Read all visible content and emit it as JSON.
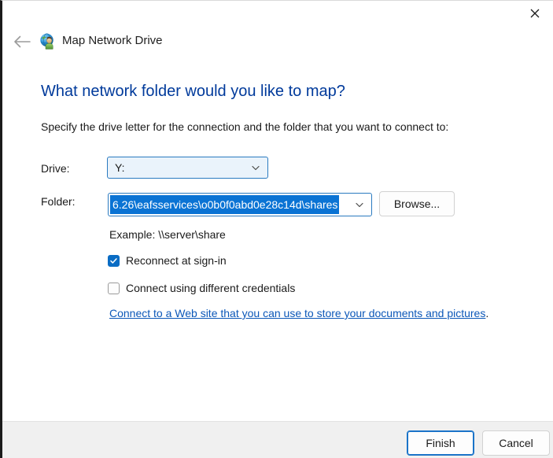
{
  "window": {
    "title": "Map Network Drive",
    "icon": "network-drive-globe-icon",
    "close_label": "✕",
    "back_label": "←"
  },
  "content": {
    "heading": "What network folder would you like to map?",
    "instruction": "Specify the drive letter for the connection and the folder that you want to connect to:",
    "drive": {
      "label": "Drive:",
      "value": "Y:",
      "options": [
        "Y:"
      ]
    },
    "folder": {
      "label": "Folder:",
      "value": "6.26\\eafsservices\\o0b0f0abd0e28c14d\\shares",
      "selected": true,
      "example": "Example: \\\\server\\share",
      "browse_label": "Browse..."
    },
    "checkboxes": [
      {
        "label": "Reconnect at sign-in",
        "checked": true
      },
      {
        "label": "Connect using different credentials",
        "checked": false
      }
    ],
    "web_link": {
      "text": "Connect to a Web site that you can use to store your documents and pictures",
      "trailing": "."
    }
  },
  "footer": {
    "finish_label": "Finish",
    "cancel_label": "Cancel"
  },
  "colors": {
    "heading_blue": "#003a9b",
    "link_blue": "#0b57b8",
    "accent_blue": "#0a6cc4",
    "selection_blue": "#0a73d4",
    "combo_border": "#2a7ac0",
    "footer_bg": "#f0f0f0"
  }
}
